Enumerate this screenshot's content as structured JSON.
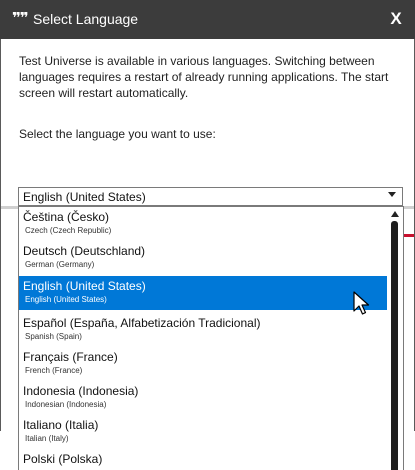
{
  "window": {
    "icon": "quote-icon",
    "icon_glyph": "❞❞",
    "title": "Select Language",
    "close_label": "X"
  },
  "dialog": {
    "description": "Test Universe is available in various languages. Switching between languages requires a restart of already running applications. The start screen will restart automatically.",
    "prompt": "Select the language you want to use:"
  },
  "language_select": {
    "selected_value": "English (United States)",
    "options": [
      {
        "name": "Čeština (Česko)",
        "english": "Czech (Czech Republic)"
      },
      {
        "name": "Deutsch (Deutschland)",
        "english": "German (Germany)"
      },
      {
        "name": "English (United States)",
        "english": "English (United States)",
        "selected": true
      },
      {
        "name": "Español (España, Alfabetización Tradicional)",
        "english": "Spanish (Spain)"
      },
      {
        "name": "Français (France)",
        "english": "French (France)"
      },
      {
        "name": "Indonesia (Indonesia)",
        "english": "Indonesian (Indonesia)"
      },
      {
        "name": "Italiano (Italia)",
        "english": "Italian (Italy)"
      },
      {
        "name": "Polski (Polska)",
        "english": ""
      }
    ]
  },
  "colors": {
    "titlebar": "#3c3c3c",
    "selection": "#0078d7",
    "accent_red": "#c8102e"
  }
}
